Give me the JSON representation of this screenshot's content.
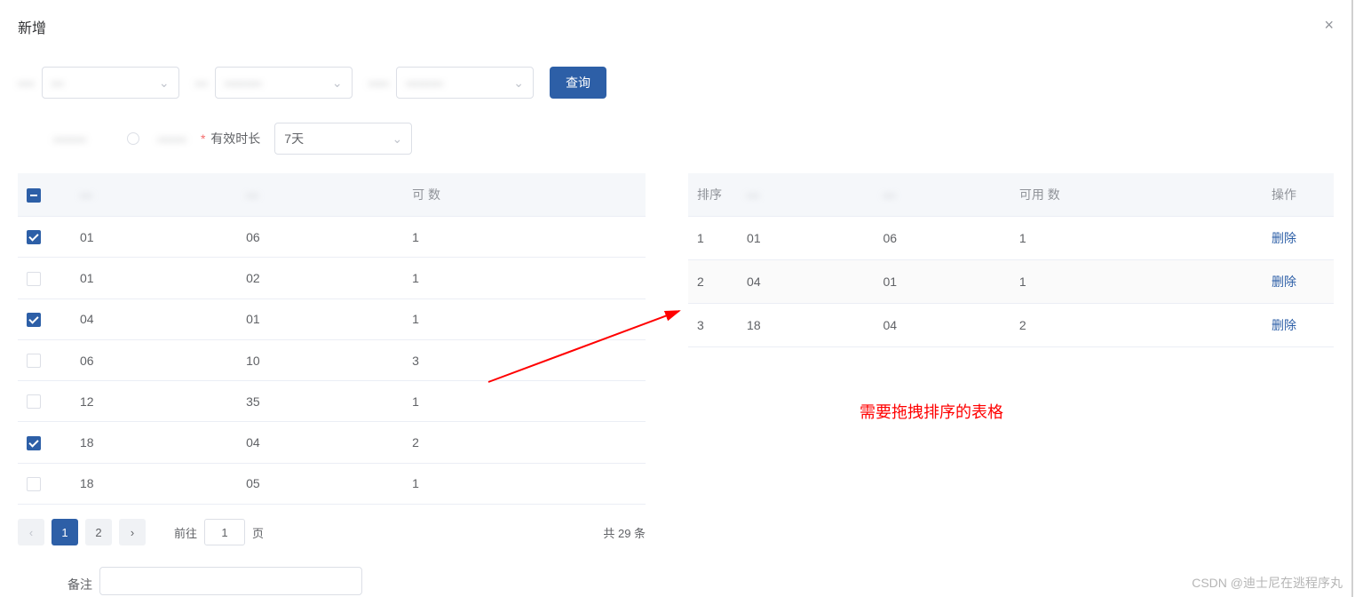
{
  "modal": {
    "title": "新增"
  },
  "filters": {
    "f1_label": "----",
    "f1_value": "---",
    "f2_label": "---",
    "f2_value": "---------",
    "f3_label": "-----",
    "f3_value": "---------",
    "search_btn": "查询"
  },
  "options": {
    "opt1_label": "--------",
    "opt2_label": "-------",
    "valid_label": "有效时长",
    "valid_value": "7天"
  },
  "left_table": {
    "headers": {
      "c1": "---",
      "c2": "---",
      "c3": "可    数"
    },
    "rows": [
      {
        "checked": true,
        "a": "01",
        "b": "06",
        "c": "1"
      },
      {
        "checked": false,
        "a": "01",
        "b": "02",
        "c": "1"
      },
      {
        "checked": true,
        "a": "04",
        "b": "01",
        "c": "1"
      },
      {
        "checked": false,
        "a": "06",
        "b": "10",
        "c": "3"
      },
      {
        "checked": false,
        "a": "12",
        "b": "35",
        "c": "1"
      },
      {
        "checked": true,
        "a": "18",
        "b": "04",
        "c": "2"
      },
      {
        "checked": false,
        "a": "18",
        "b": "05",
        "c": "1"
      }
    ]
  },
  "right_table": {
    "headers": {
      "order": "排序",
      "c1": "---",
      "c2": "---",
      "c3": "可用  数",
      "action": "操作"
    },
    "rows": [
      {
        "order": "1",
        "a": "01",
        "b": "06",
        "c": "1",
        "del": "删除"
      },
      {
        "order": "2",
        "a": "04",
        "b": "01",
        "c": "1",
        "del": "删除"
      },
      {
        "order": "3",
        "a": "18",
        "b": "04",
        "c": "2",
        "del": "删除"
      }
    ]
  },
  "pagination": {
    "pages": [
      "1",
      "2"
    ],
    "goto_prefix": "前往",
    "goto_value": "1",
    "goto_suffix": "页",
    "total_text": "共 29 条"
  },
  "remark_label": "备注",
  "annotation_text": "需要拖拽排序的表格",
  "watermark": "CSDN @迪士尼在逃程序丸"
}
